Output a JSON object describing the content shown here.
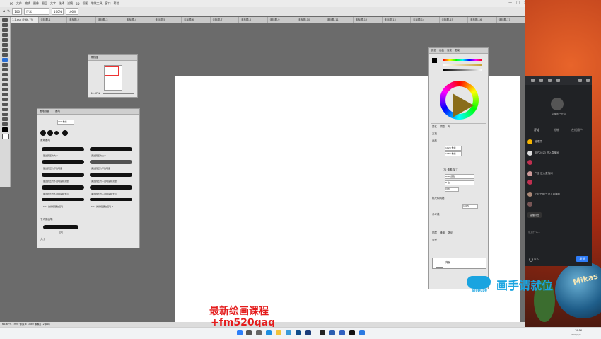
{
  "menu": [
    "PS",
    "文件",
    "编辑",
    "图像",
    "图层",
    "文字",
    "选择",
    "滤镜",
    "3D",
    "视图",
    "增效工具",
    "窗口",
    "帮助"
  ],
  "options": {
    "size": "100",
    "mode": "正常",
    "opacity": "100%",
    "flow": "100%"
  },
  "doc_tabs": [
    "1-1.psd @ 66.7%",
    "未标题-1",
    "未标题-2",
    "未标题-3",
    "未标题-4",
    "未标题-5",
    "未标题-6",
    "未标题-7",
    "未标题-8",
    "未标题-9",
    "未标题-10",
    "未标题-11",
    "未标题-12",
    "未标题-13",
    "未标题-14",
    "未标题-15",
    "未标题-16",
    "未标题-17"
  ],
  "navigator": {
    "title": "导航器",
    "zoom": "66.67%"
  },
  "brushes_panel": {
    "tabs": [
      "画笔设置",
      "画笔"
    ],
    "size": "100 像素",
    "group": "常规画笔",
    "items": [
      "硬边圆压力大小",
      "柔边圆压力大小",
      "硬边圆压力不透明度",
      "柔边圆压力不透明度",
      "硬边圆压力不透明度和流量",
      "柔边圆压力不透明度和流量",
      "硬边圆压力不透明度和大小",
      "柔边圆压力不透明度和大小",
      "Kyle 的终极硬边铅笔",
      "Kyle 的终极硬边铅笔 2"
    ],
    "group2": "干介质画笔",
    "last": "铅笔",
    "footer": "大小"
  },
  "color_panel": {
    "tabs": [
      "颜色",
      "色板",
      "渐变",
      "图案"
    ],
    "props_tabs": [
      "属性",
      "调整",
      "库"
    ],
    "props_title": "文档",
    "canvas_label": "画布",
    "w": "1920 像素",
    "h": "1080 像素",
    "res": "72 像素/英寸",
    "mode": "RGB 颜色",
    "bits": "8 位",
    "fill": "白色",
    "rulers": "标尺和网格",
    "zoom": "100%",
    "guides": "参考线",
    "layers_tabs": [
      "图层",
      "通道",
      "路径"
    ],
    "kind": "类型",
    "layer_name": "背景"
  },
  "status": "66.67%  1920 像素 x 1080 像素 (72 ppi)",
  "chat": {
    "title": "直播间已开启",
    "tabs": [
      "评论",
      "礼物",
      "在线用户"
    ],
    "messages": [
      "管理员",
      "用户2023 进入直播间",
      "户主 进入直播间",
      "小红书用户 进入直播间",
      "直播标签"
    ],
    "input_hint": "说点什么...",
    "checkbox": "匿名",
    "send": "发送"
  },
  "promo": {
    "line1": "最新绘画课程",
    "line2": "+fm520qaq"
  },
  "logo": {
    "text": "画手请就位",
    "sub": "BIUDUDU"
  },
  "ball_text": "Mikas",
  "clock": {
    "time": "19:56",
    "date": "2023/3/2"
  }
}
